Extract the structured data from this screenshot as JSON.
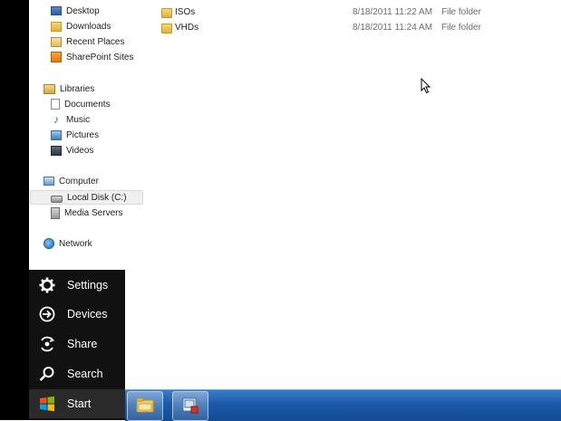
{
  "nav": {
    "favorites": [
      {
        "label": "Desktop",
        "icon": "desktop-icon"
      },
      {
        "label": "Downloads",
        "icon": "downloads-folder-icon"
      },
      {
        "label": "Recent Places",
        "icon": "recent-places-icon"
      },
      {
        "label": "SharePoint Sites",
        "icon": "sharepoint-icon"
      }
    ],
    "libraries": {
      "label": "Libraries",
      "icon": "libraries-icon"
    },
    "library_items": [
      {
        "label": "Documents",
        "icon": "documents-icon"
      },
      {
        "label": "Music",
        "icon": "music-note-icon"
      },
      {
        "label": "Pictures",
        "icon": "pictures-icon"
      },
      {
        "label": "Videos",
        "icon": "videos-icon"
      }
    ],
    "computer": {
      "label": "Computer",
      "icon": "computer-icon"
    },
    "computer_items": [
      {
        "label": "Local Disk (C:)",
        "icon": "hard-disk-icon",
        "selected": true
      },
      {
        "label": "Media Servers",
        "icon": "media-server-icon"
      }
    ],
    "network": {
      "label": "Network",
      "icon": "network-icon"
    }
  },
  "files": [
    {
      "name": "ISOs",
      "date": "8/18/2011 11:22 AM",
      "type": "File folder"
    },
    {
      "name": "VHDs",
      "date": "8/18/2011 11:24 AM",
      "type": "File folder"
    }
  ],
  "charms": [
    {
      "label": "Settings",
      "icon": "gear-icon"
    },
    {
      "label": "Devices",
      "icon": "devices-icon"
    },
    {
      "label": "Share",
      "icon": "share-icon"
    },
    {
      "label": "Search",
      "icon": "search-icon"
    },
    {
      "label": "Start",
      "icon": "windows-logo-icon"
    }
  ],
  "taskbar": {
    "buttons": [
      {
        "icon": "file-explorer-icon"
      },
      {
        "icon": "remote-desktop-icon"
      }
    ]
  },
  "colors": {
    "charm_background": "#111111",
    "taskbar": "#1c5aa8",
    "selection": "#f0f0f0"
  }
}
